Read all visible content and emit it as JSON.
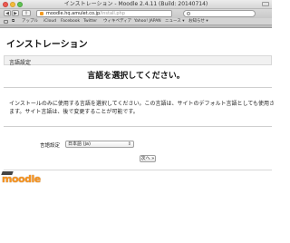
{
  "window": {
    "title": "インストレーション - Moodle 2.4.11 (Build: 20140714)"
  },
  "toolbar": {
    "back": "◀",
    "forward": "▶",
    "share": "⇪",
    "url_host": "moodle.hq.amulet.co.jp",
    "url_path": "/install.php"
  },
  "bookmarks": {
    "items": [
      "アップル",
      "iCloud",
      "Facebook",
      "Twitter",
      "ウィキペディア",
      "Yahoo! JAPAN",
      "ニュース ▾",
      "お知らせ ▾"
    ]
  },
  "page": {
    "title": "インストレーション",
    "section_label": "言語設定",
    "heading": "言語を選択してください。",
    "info_line1": "インストールのみに使用する言語を選択してください。この言語は、サイトのデフォルト言語としても使用さ",
    "info_line2": "ます。サイト言語は、後で変更することが可能です。",
    "lang_label": "言語設定",
    "lang_selected": "日本語 (ja)",
    "next_button": "次へ »",
    "logo_text": "moodle"
  }
}
